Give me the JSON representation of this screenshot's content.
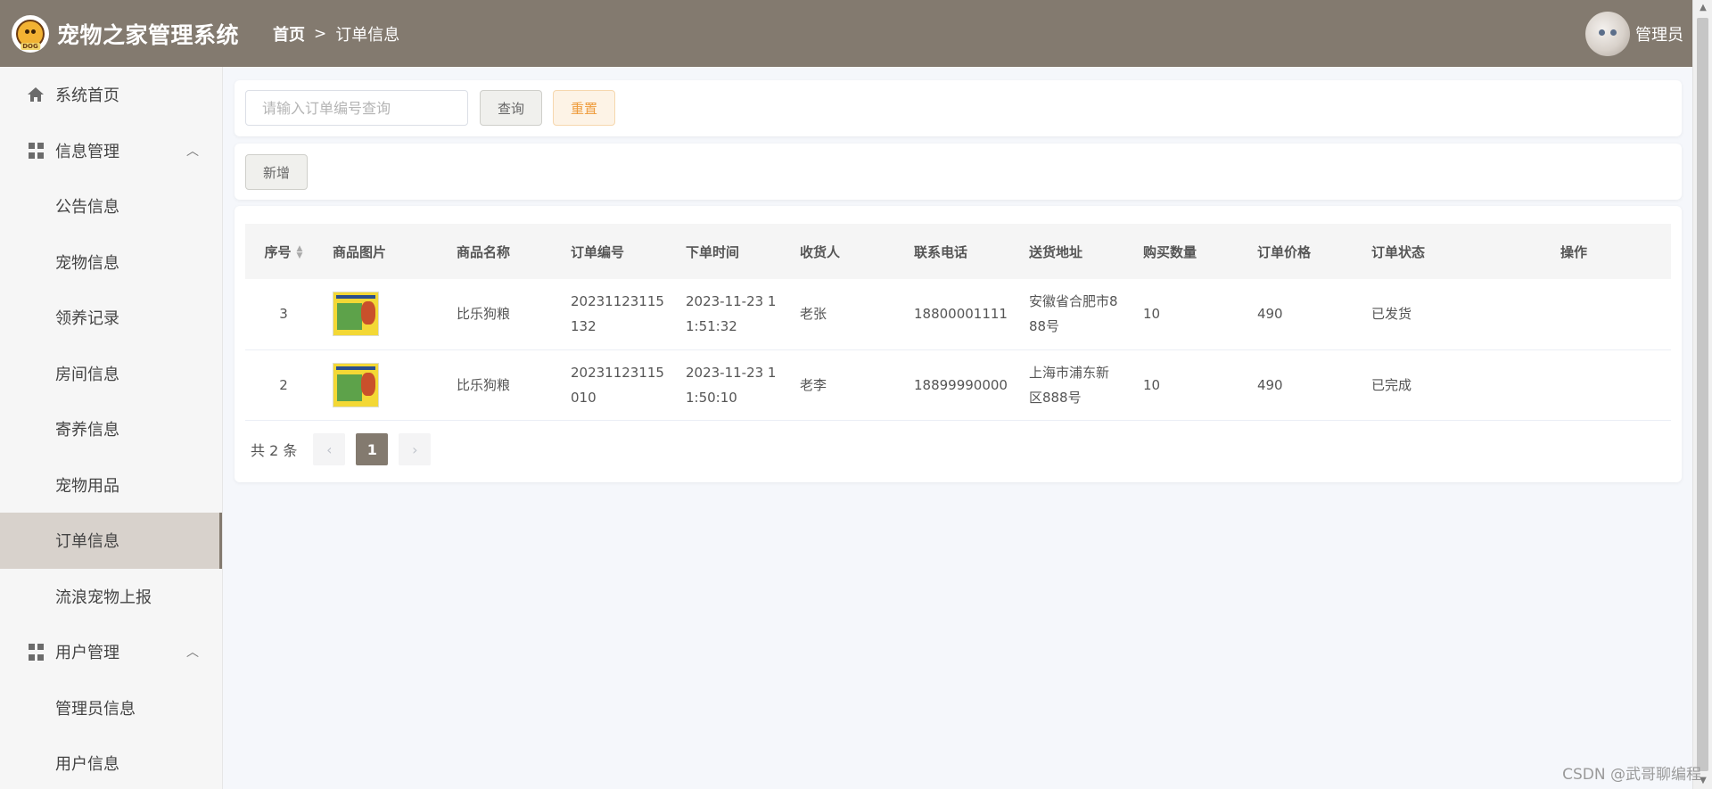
{
  "header": {
    "app_title": "宠物之家管理系统",
    "logo_text": "DOG",
    "breadcrumb": {
      "home": "首页",
      "separator": ">",
      "current": "订单信息"
    },
    "user_name": "管理员",
    "bg_color": "#837a6f"
  },
  "sidebar": {
    "items": [
      {
        "label": "系统首页",
        "icon": "home-icon"
      },
      {
        "label": "信息管理",
        "icon": "grid-icon",
        "expanded": true
      },
      {
        "label": "公告信息"
      },
      {
        "label": "宠物信息"
      },
      {
        "label": "领养记录"
      },
      {
        "label": "房间信息"
      },
      {
        "label": "寄养信息"
      },
      {
        "label": "宠物用品"
      },
      {
        "label": "订单信息",
        "active": true
      },
      {
        "label": "流浪宠物上报"
      },
      {
        "label": "用户管理",
        "icon": "grid-icon",
        "expanded": true
      },
      {
        "label": "管理员信息"
      },
      {
        "label": "用户信息"
      }
    ]
  },
  "search": {
    "placeholder": "请输入订单编号查询",
    "query_label": "查询",
    "reset_label": "重置"
  },
  "actions": {
    "add_label": "新增"
  },
  "table": {
    "columns": [
      "序号",
      "商品图片",
      "商品名称",
      "订单编号",
      "下单时间",
      "收货人",
      "联系电话",
      "送货地址",
      "购买数量",
      "订单价格",
      "订单状态",
      "操作"
    ],
    "rows": [
      {
        "no": "3",
        "name": "比乐狗粮",
        "order_no_1": "20231123115",
        "order_no_2": "132",
        "time_1": "2023-11-23 1",
        "time_2": "1:51:32",
        "receiver": "老张",
        "phone": "18800001111",
        "addr_1": "安徽省合肥市8",
        "addr_2": "88号",
        "qty": "10",
        "price": "490",
        "status": "已发货"
      },
      {
        "no": "2",
        "name": "比乐狗粮",
        "order_no_1": "20231123115",
        "order_no_2": "010",
        "time_1": "2023-11-23 1",
        "time_2": "1:50:10",
        "receiver": "老李",
        "phone": "18899990000",
        "addr_1": "上海市浦东新",
        "addr_2": "区888号",
        "qty": "10",
        "price": "490",
        "status": "已完成"
      }
    ]
  },
  "pagination": {
    "total_text": "共 2 条",
    "prev": "‹",
    "current_page": "1",
    "next": "›"
  },
  "watermark": "CSDN @武哥聊编程"
}
